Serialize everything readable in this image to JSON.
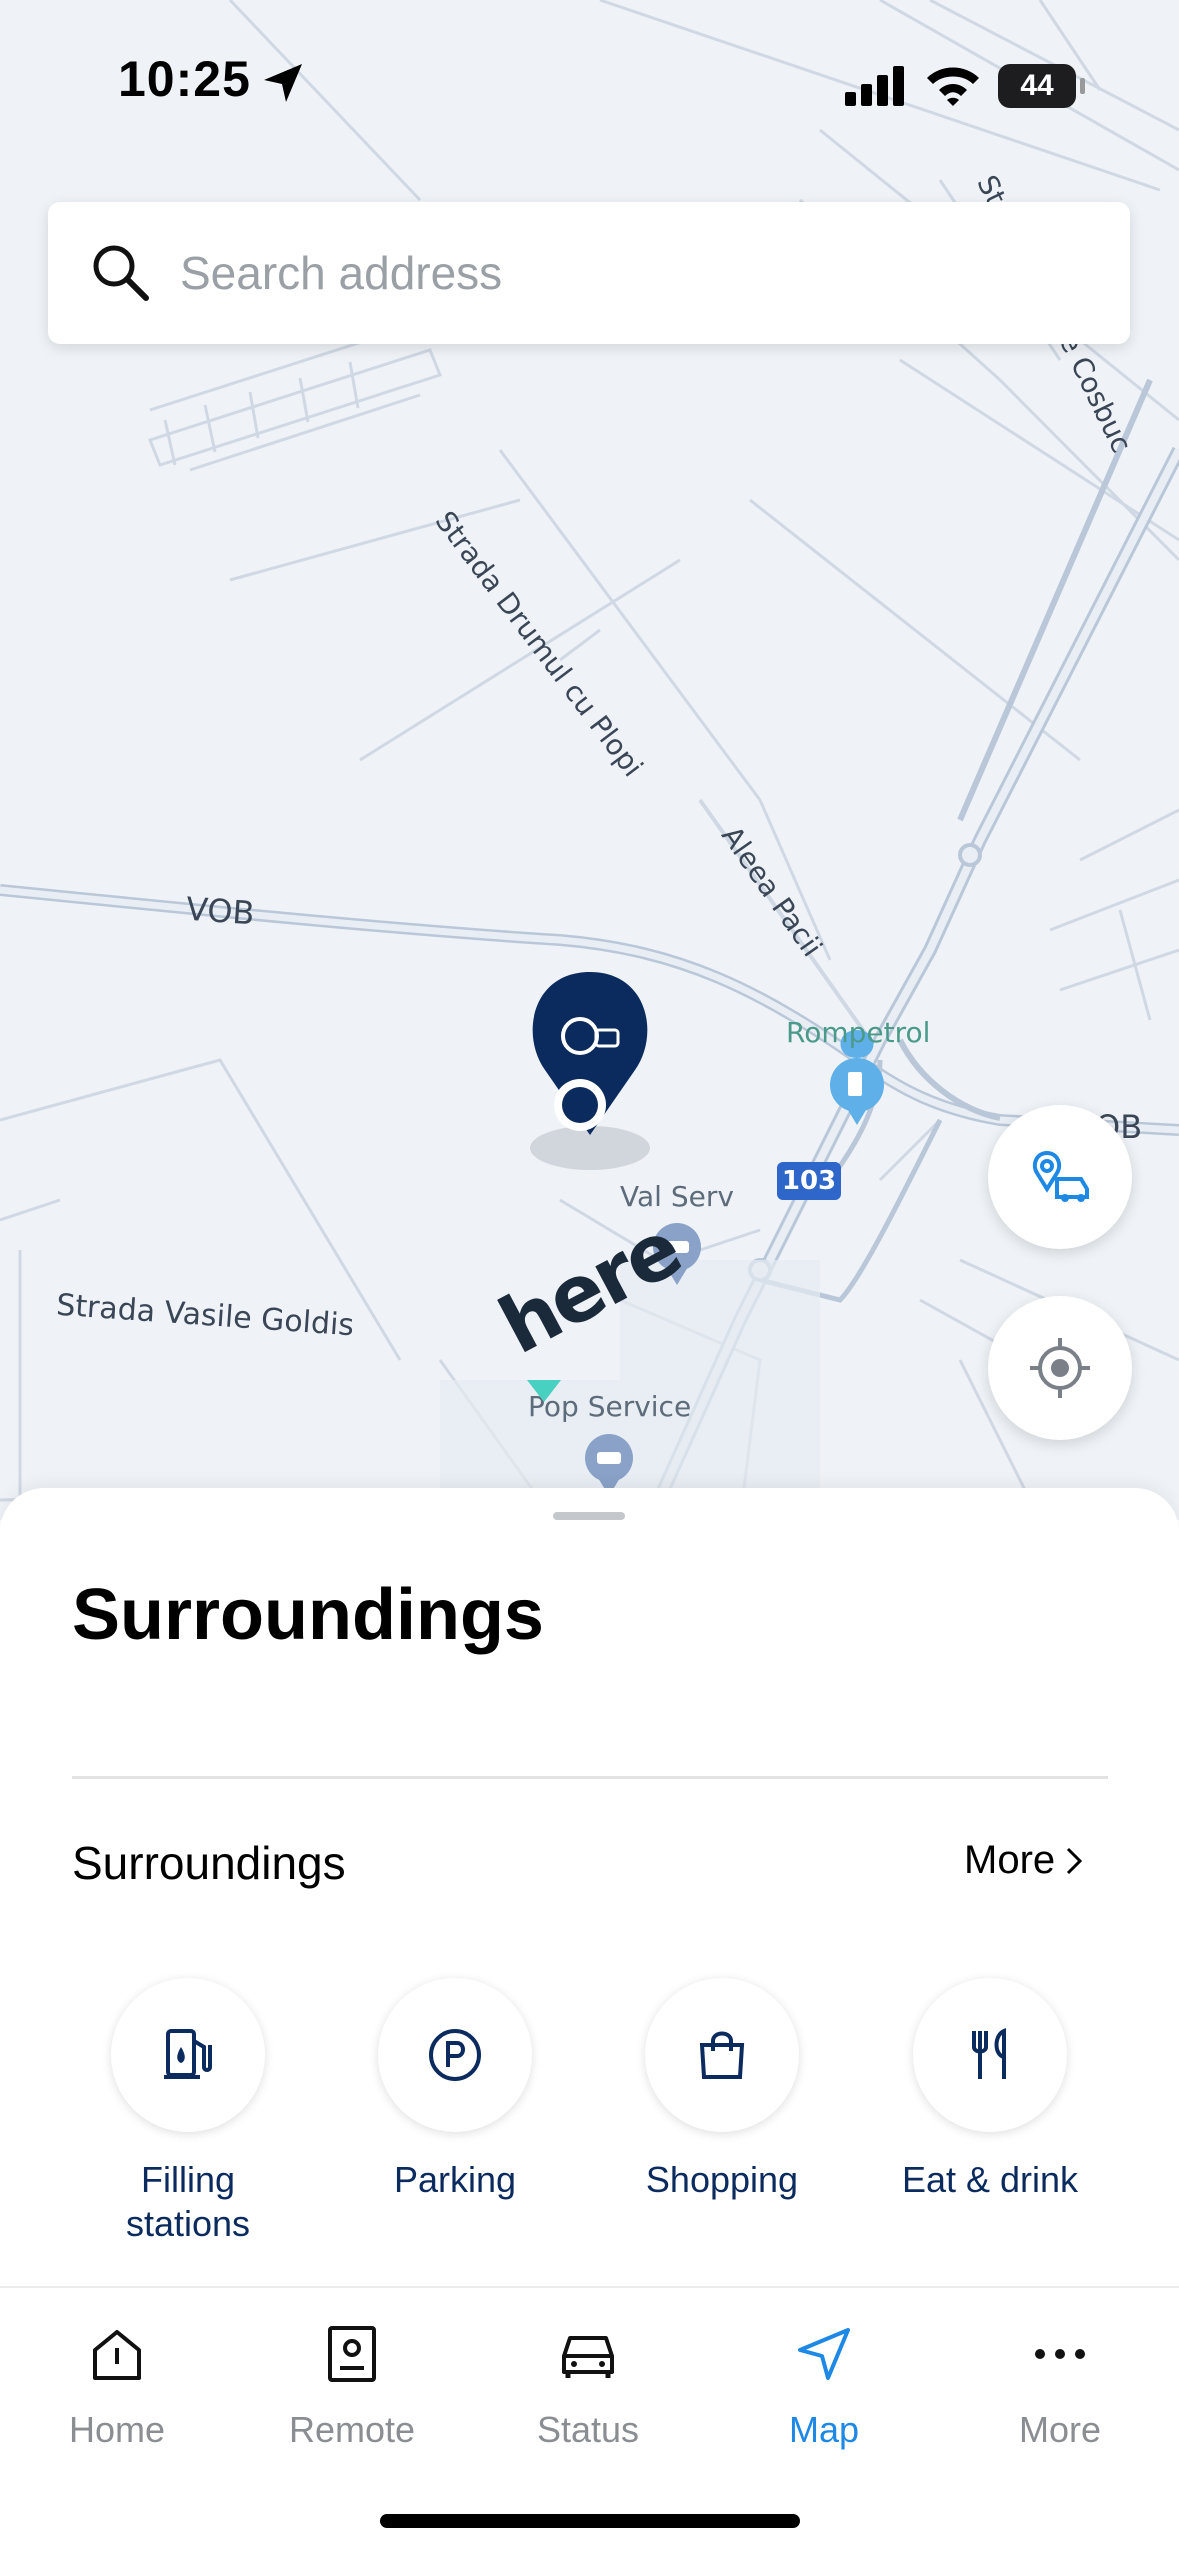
{
  "status_bar": {
    "time": "10:25",
    "battery": "44"
  },
  "search": {
    "placeholder": "Search address"
  },
  "map": {
    "road_labels": [
      "Strada Drumul cu Plopi",
      "Aleea Pacii",
      "VOB",
      "Strada Vasile Goldis",
      "Str",
      "e Cosbuc",
      "OB"
    ],
    "pois": [
      "Rompetrol",
      "Val Serv",
      "Pop Service"
    ],
    "route_shield": "103",
    "map_provider": "here"
  },
  "sheet": {
    "title": "Surroundings",
    "section_title": "Surroundings",
    "more_label": "More",
    "categories": [
      {
        "label": "Filling stations",
        "icon": "fuel-pump-icon"
      },
      {
        "label": "Parking",
        "icon": "parking-icon"
      },
      {
        "label": "Shopping",
        "icon": "shopping-bag-icon"
      },
      {
        "label": "Eat & drink",
        "icon": "fork-knife-icon"
      }
    ]
  },
  "tabbar": {
    "tabs": [
      {
        "label": "Home",
        "icon": "home-icon",
        "active": false
      },
      {
        "label": "Remote",
        "icon": "remote-icon",
        "active": false
      },
      {
        "label": "Status",
        "icon": "car-icon",
        "active": false
      },
      {
        "label": "Map",
        "icon": "navigation-arrow-icon",
        "active": true
      },
      {
        "label": "More",
        "icon": "more-dots-icon",
        "active": false
      }
    ]
  },
  "colors": {
    "accent": "#1e88e5",
    "brand_navy": "#0b2a5e",
    "map_bg": "#eff3f7"
  }
}
